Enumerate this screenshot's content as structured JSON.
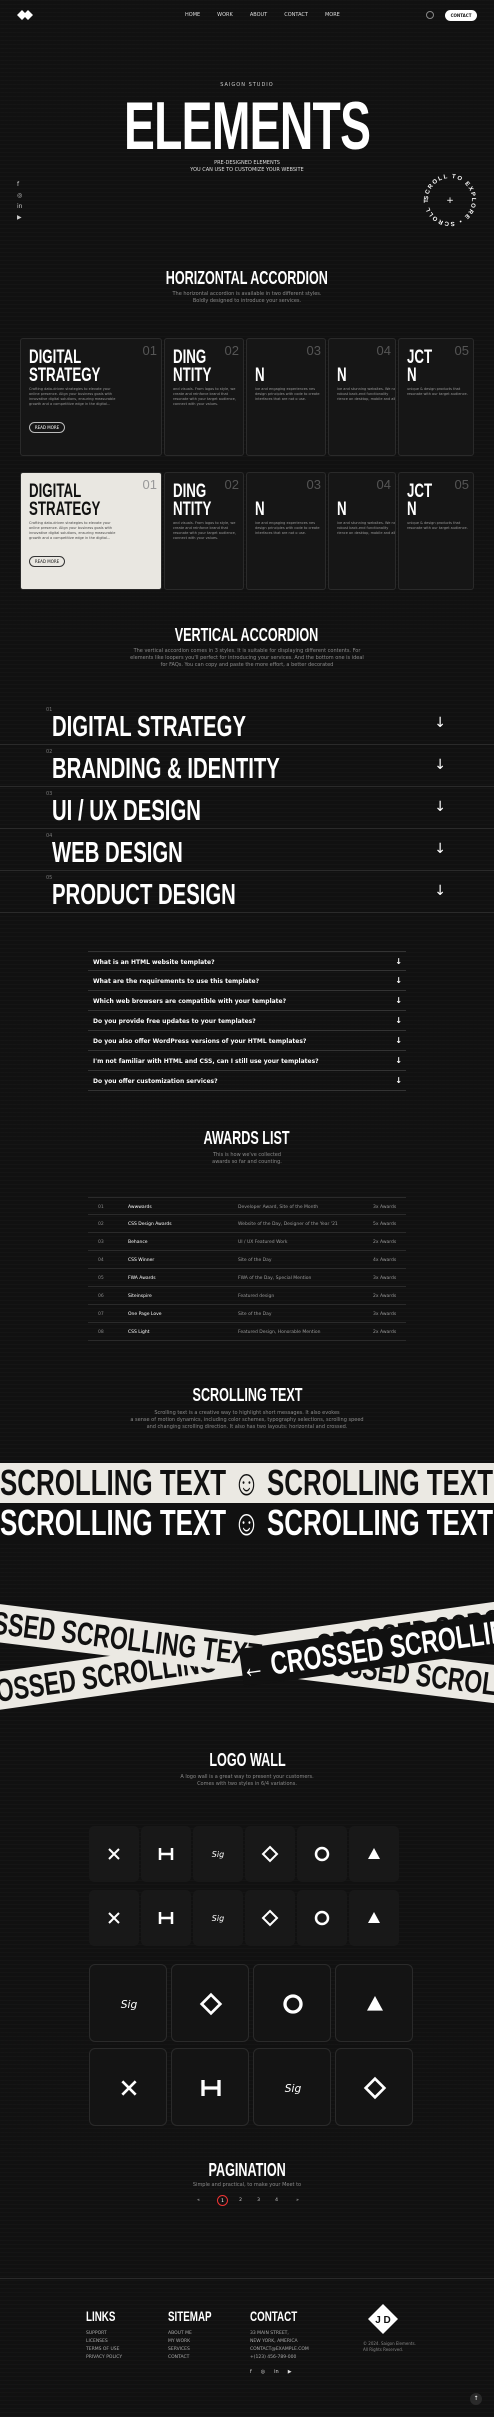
{
  "header": {
    "nav": [
      "HOME",
      "WORK",
      "ABOUT",
      "CONTACT",
      "MORE"
    ],
    "contact_button": "CONTACT"
  },
  "hero": {
    "tag": "SAIGON STUDIO",
    "title": "ELEMENTS",
    "tagline_1": "PRE-DESIGNED ELEMENTS",
    "tagline_2": "YOU CAN USE TO CUSTOMIZE YOUR WEBSITE",
    "circle_text": "SCROLL TO EXPLORE • SCROLL TO EXPLORE •"
  },
  "horizontal": {
    "title": "HORIZONTAL ACCORDION",
    "sub_1": "The horizontal accordion is available in two different styles.",
    "sub_2": "Boldly designed to introduce your services.",
    "panel_title_1": "DIGITAL",
    "panel_title_2": "STRATEGY",
    "panel_desc": "Crafting data-driven strategies to elevate your online presence. Align your business goals with innovative digital solutions, ensuring measurable growth and a competitive edge in the digital...",
    "read_more": "READ MORE",
    "numbers": [
      "01",
      "02",
      "03",
      "04",
      "05"
    ],
    "peek_1": "DING",
    "peek_2": "NTITY",
    "peek_3": "N",
    "peek_4": "N",
    "peek_5a": "JCT",
    "peek_5b": "N",
    "peek_desc_2": "and visuals. From logos to style, we create and reinforce brand that resonate with your target audience, connect with your values.",
    "peek_desc_3": "ive and engaging experiences nes design principles with code to create interfaces that are not o use.",
    "peek_desc_4": "ive and stunning websites. We nd robust back-end functionality rience on desktop, mobile and all",
    "peek_desc_5": "unique & design products that resonate with our target audience."
  },
  "vertical": {
    "title": "VERTICAL ACCORDION",
    "sub_1": "The vertical accordion comes in 3 styles. It is suitable for displaying different contents. For",
    "sub_2": "elements like loopers you'll perfect for introducing your services. And the bottom one is ideal",
    "sub_3": "for FAQs. You can copy and paste the more effort, a better decorated",
    "items": [
      "DIGITAL STRATEGY",
      "BRANDING & IDENTITY",
      "UI / UX DESIGN",
      "WEB DESIGN",
      "PRODUCT DESIGN"
    ],
    "dots": [
      "01",
      "02",
      "03",
      "04",
      "05"
    ]
  },
  "faq": [
    "What is an HTML website template?",
    "What are the requirements to use this template?",
    "Which web browsers are compatible with your template?",
    "Do you provide free updates to your templates?",
    "Do you also offer WordPress versions of your HTML templates?",
    "I'm not familiar with HTML and CSS, can I still use your templates?",
    "Do you offer customization services?"
  ],
  "awards": {
    "title": "AWARDS LIST",
    "sub_1": "This is how we've collected",
    "sub_2": "awards so far and counting.",
    "rows": [
      {
        "n": "01",
        "name": "Awwwards",
        "desc": "Developer Award, Site of the Month",
        "count": "3x Awards"
      },
      {
        "n": "02",
        "name": "CSS Design Awards",
        "desc": "Website of the Day, Designer of the Year '21",
        "count": "5x Awards"
      },
      {
        "n": "03",
        "name": "Behance",
        "desc": "UI / UX Featured Work",
        "count": "2x Awards"
      },
      {
        "n": "04",
        "name": "CSS Winner",
        "desc": "Site of the Day",
        "count": "4x Awards"
      },
      {
        "n": "05",
        "name": "FWA Awards",
        "desc": "FWA of the Day, Special Mention",
        "count": "3x Awards"
      },
      {
        "n": "06",
        "name": "Siteinspire",
        "desc": "Featured design",
        "count": "2x Awards"
      },
      {
        "n": "07",
        "name": "One Page Love",
        "desc": "Site of the Day",
        "count": "3x Awards"
      },
      {
        "n": "08",
        "name": "CSS Light",
        "desc": "Featured Design, Honorable Mention",
        "count": "2x Awards"
      }
    ]
  },
  "scrolling": {
    "title": "SCROLLING TEXT",
    "sub_1": "Scrolling text is a creative way to highlight short messages. It also evokes",
    "sub_2": "a sense of motion dynamics, including color schemes, typography selections, scrolling speed",
    "sub_3": "and changing scrolling direction. It also has two layouts: horizontal and crossed.",
    "text": "SCROLLING TEXT",
    "crossed_text": "CROSSED SCROLLING TEXT"
  },
  "logo_wall": {
    "title": "LOGO WALL",
    "sub_1": "A logo wall is a great way to present your customers.",
    "sub_2": "Comes with two styles in 6/4 variations."
  },
  "pagination": {
    "title": "PAGINATION",
    "sub": "Simple and practical, to make your Meet to",
    "prev": "«",
    "next": "»",
    "pages": [
      "1",
      "2",
      "3",
      "4"
    ]
  },
  "footer": {
    "links_title": "LINKS",
    "links": [
      "SUPPORT",
      "LICENSES",
      "TERMS OF USE",
      "PRIVACY POLICY"
    ],
    "sitemap_title": "SITEMAP",
    "sitemap": [
      "ABOUT ME",
      "MY WORK",
      "SERVICES",
      "CONTACT"
    ],
    "contact_title": "CONTACT",
    "contact": [
      "33 MAIN STREET,",
      "NEW YORK, AMERICA",
      "CONTACT@EXAMPLE.COM",
      "+(123) 456-789-000"
    ],
    "social": [
      "f",
      "◎",
      "in",
      "▶"
    ],
    "copyright_1": "© 2024. Saigon Elements.",
    "copyright_2": "All Rights Reserved.",
    "back_to_top": "↑"
  }
}
